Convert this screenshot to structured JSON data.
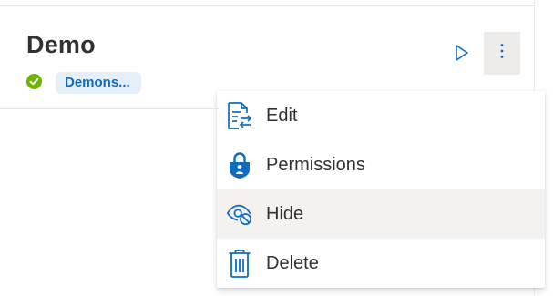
{
  "card": {
    "title": "Demo",
    "status_icon": "check-circle-icon",
    "tag_label": "Demons..."
  },
  "actions": {
    "run_icon": "play-icon",
    "more_icon": "more-vertical-icon"
  },
  "menu": {
    "items": [
      {
        "label": "Edit",
        "icon": "edit-document-icon"
      },
      {
        "label": "Permissions",
        "icon": "lock-shield-icon"
      },
      {
        "label": "Hide",
        "icon": "hide-eye-icon"
      },
      {
        "label": "Delete",
        "icon": "trash-icon"
      }
    ]
  },
  "colors": {
    "accent": "#0f6cbd",
    "success": "#6bb700",
    "hover": "#f3f2f1",
    "text": "#323130"
  }
}
